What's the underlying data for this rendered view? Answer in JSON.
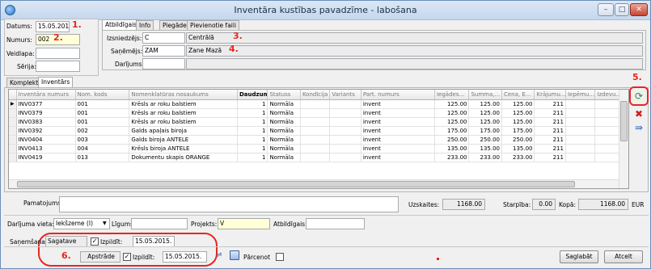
{
  "window": {
    "title": "Inventāra kustības pavadzīme - labošana",
    "min": "–",
    "max": "□",
    "close": "✕"
  },
  "header": {
    "datums_label": "Datums:",
    "datums_value": "15.05.2015.",
    "numurs_label": "Numurs:",
    "numurs_value": "002",
    "veidlapa_label": "Veidlapa:",
    "veidlapa_value": "",
    "serija_label": "Sērija:",
    "serija_value": ""
  },
  "annotations": {
    "m1": "1.",
    "m2": "2.",
    "m3": "3.",
    "m4": "4.",
    "m5": "5.",
    "m6": "6."
  },
  "top_tabs": [
    "Atbildīgais",
    "Info",
    "Piegāde",
    "Pievienotie faili"
  ],
  "atbildigais": {
    "izsniedzejs_label": "Izsniedzējs:",
    "izsniedzejs_code": "C",
    "izsniedzejs_name": "Centrālā",
    "sanemejs_label": "Saņēmējs:",
    "sanemejs_code": "ZAM",
    "sanemejs_name": "Zane Mazā",
    "darijums_label": "Darījums:",
    "darijums_code": "",
    "darijums_name": ""
  },
  "main_tabs": [
    "Komplekti",
    "Inventārs"
  ],
  "grid": {
    "columns": [
      "Inventāra numurs",
      "Nom. kods",
      "Nomenklatūras nosaukums",
      "Daudzums",
      "Statuss",
      "Kondīcija",
      "Variants",
      "Part. numurs",
      "Iegādes...",
      "Summa,...",
      "Cena, E...",
      "Krājumu...",
      "Iepēmu...",
      "Izdevu..."
    ],
    "rows": [
      [
        "INV0377",
        "001",
        "Krēsls ar roku balstiem",
        "1",
        "Normāla",
        "",
        "",
        "invent",
        "125.00",
        "125.00",
        "125.00",
        "211",
        "",
        ""
      ],
      [
        "INV0379",
        "001",
        "Krēsls ar roku balstiem",
        "1",
        "Normāla",
        "",
        "",
        "invent",
        "125.00",
        "125.00",
        "125.00",
        "211",
        "",
        ""
      ],
      [
        "INV0383",
        "001",
        "Krēsls ar roku balstiem",
        "1",
        "Normāla",
        "",
        "",
        "invent",
        "125.00",
        "125.00",
        "125.00",
        "211",
        "",
        ""
      ],
      [
        "INV0392",
        "002",
        "Galds apaļais biroja",
        "1",
        "Normāla",
        "",
        "",
        "invent",
        "175.00",
        "175.00",
        "175.00",
        "211",
        "",
        ""
      ],
      [
        "INV0404",
        "003",
        "Galds biroja ANTELE",
        "1",
        "Normāla",
        "",
        "",
        "invent",
        "250.00",
        "250.00",
        "250.00",
        "211",
        "",
        ""
      ],
      [
        "INV0413",
        "004",
        "Krēsls biroja ANTELE",
        "1",
        "Normāla",
        "",
        "",
        "invent",
        "135.00",
        "135.00",
        "135.00",
        "211",
        "",
        ""
      ],
      [
        "INV0419",
        "013",
        "Dokumentu skapis ORANGE",
        "1",
        "Normāla",
        "",
        "",
        "invent",
        "233.00",
        "233.00",
        "233.00",
        "211",
        "",
        ""
      ]
    ]
  },
  "totals": {
    "pamatojums_label": "Pamatojums:",
    "pamatojums_value": "",
    "uzskaites_label": "Uzskaites:",
    "uzskaites_value": "1168.00",
    "starpiba_label": "Starpība:",
    "starpiba_value": "0.00",
    "kopa_label": "Kopā:",
    "kopa_value": "1168.00",
    "currency": "EUR"
  },
  "details": {
    "vieta_label": "Darījuma vieta:",
    "vieta_value": "Iekšzeme (I)",
    "ligums_label": "Līgums:",
    "ligums_value": "",
    "projekts_label": "Projekts:",
    "projekts_value": "V",
    "atbildigais_label": "Atbildīgais:",
    "atbildigais_value": ""
  },
  "sanemsana": {
    "label": "Saņemšana:",
    "status": "Sagatave",
    "izpildit_label": "Izpildīt:",
    "izpildit_checked": "✓",
    "date": "15.05.2015."
  },
  "apstrade": {
    "status": "Apstrāde",
    "izpildit_label": "Izpildīt:",
    "izpildit_checked": "✓",
    "date": "15.05.2015.",
    "parcenot_label": "Pārcenot"
  },
  "buttons": {
    "save": "Saglabāt",
    "cancel": "Atcelt"
  },
  "colors": {
    "annotation_red": "#e8261f",
    "yellow_field": "#ffffd8"
  }
}
